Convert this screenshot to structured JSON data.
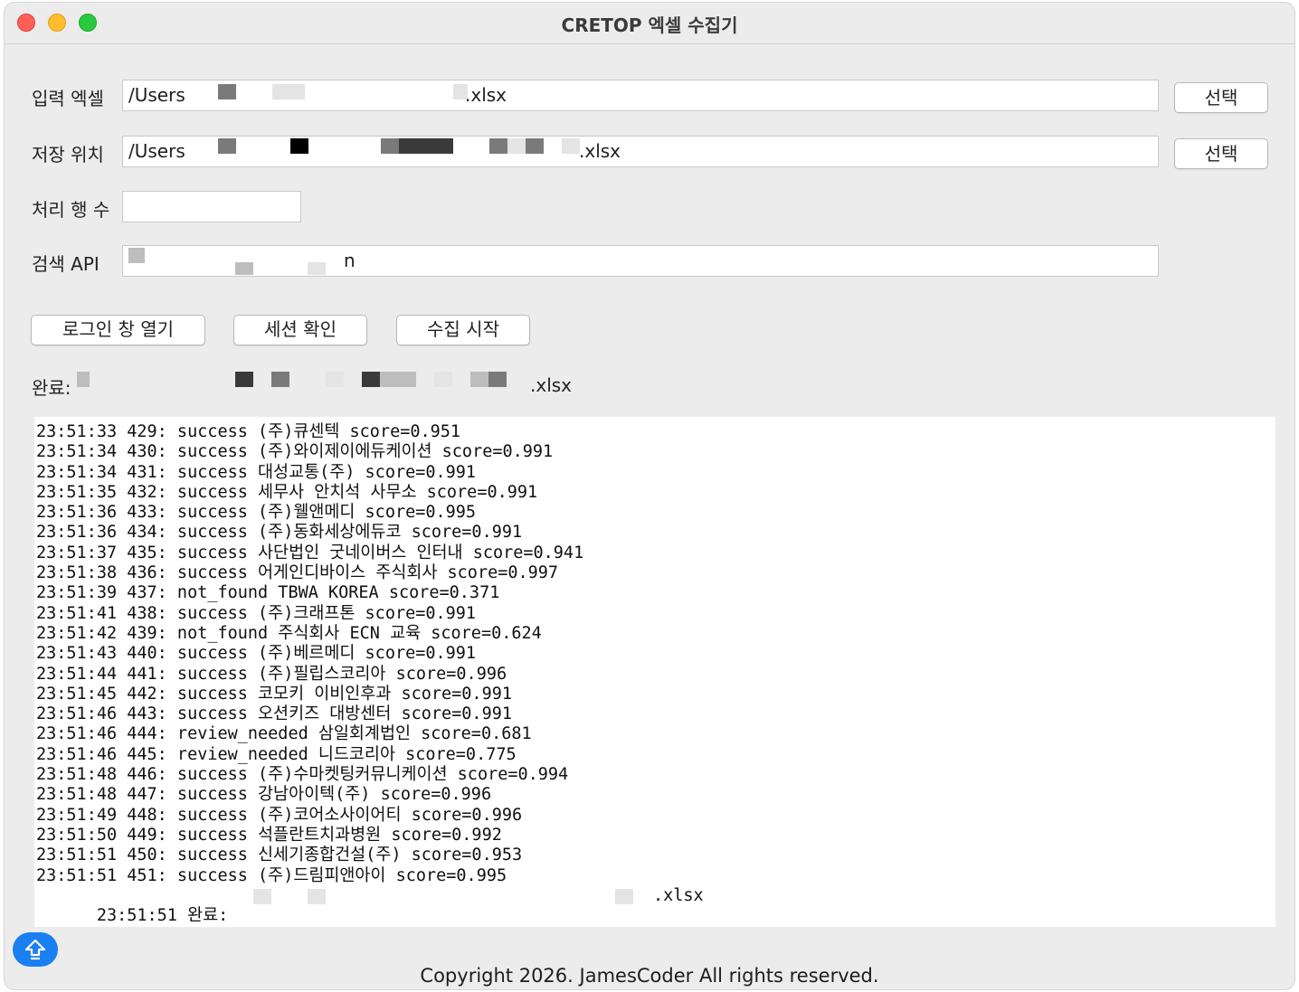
{
  "window": {
    "title": "CRETOP 엑셀 수집기"
  },
  "form": {
    "input_excel": {
      "label": "입력 엑셀",
      "value_start": "/Users",
      "value_end": ".xlsx",
      "button": "선택"
    },
    "save_location": {
      "label": "저장 위치",
      "value_start": "/Users",
      "value_end": ".xlsx",
      "button": "선택"
    },
    "row_count": {
      "label": "처리 행 수",
      "value": ""
    },
    "search_api": {
      "label": "검색 API",
      "value_end": "n"
    }
  },
  "actions": {
    "open_login": "로그인 창 열기",
    "check_session": "세션 확인",
    "start_collect": "수집 시작"
  },
  "status": {
    "label": "완료:",
    "value_end": ".xlsx"
  },
  "log": {
    "lines": [
      "23:51:33 429: success (주)큐센텍 score=0.951",
      "23:51:34 430: success (주)와이제이에듀케이션 score=0.991",
      "23:51:34 431: success 대성교통(주) score=0.991",
      "23:51:35 432: success 세무사 안치석 사무소 score=0.991",
      "23:51:36 433: success (주)웰앤메디 score=0.995",
      "23:51:36 434: success (주)동화세상에듀코 score=0.991",
      "23:51:37 435: success 사단법인 굿네이버스 인터내 score=0.941",
      "23:51:38 436: success 어게인디바이스 주식회사 score=0.997",
      "23:51:39 437: not_found TBWA KOREA score=0.371",
      "23:51:41 438: success (주)크래프톤 score=0.991",
      "23:51:42 439: not_found 주식회사 ECN 교육 score=0.624",
      "23:51:43 440: success (주)베르메디 score=0.991",
      "23:51:44 441: success (주)필립스코리아 score=0.996",
      "23:51:45 442: success 코모키 이비인후과 score=0.991",
      "23:51:46 443: success 오션키즈 대방센터 score=0.991",
      "23:51:46 444: review_needed 삼일회계법인 score=0.681",
      "23:51:46 445: review_needed 니드코리아 score=0.775",
      "23:51:48 446: success (주)수마켓팅커뮤니케이션 score=0.994",
      "23:51:48 447: success 강남아이텍(주) score=0.996",
      "23:51:49 448: success (주)코어소사이어티 score=0.996",
      "23:51:50 449: success 석플란트치과병원 score=0.992",
      "23:51:51 450: success 신세기종합건설(주) score=0.953",
      "23:51:51 451: success (주)드림피앤아이 score=0.995"
    ],
    "final_prefix": "23:51:51 완료:",
    "final_suffix": ".xlsx"
  },
  "footer": {
    "copyright": "Copyright 2026. JamesCoder All rights reserved."
  },
  "icons": {
    "scroll_top": "arrow-up-icon"
  },
  "colors": {
    "accent": "#1a7ff0",
    "close": "#fe5f57",
    "minimize": "#febc2e",
    "maximize": "#28c840"
  }
}
